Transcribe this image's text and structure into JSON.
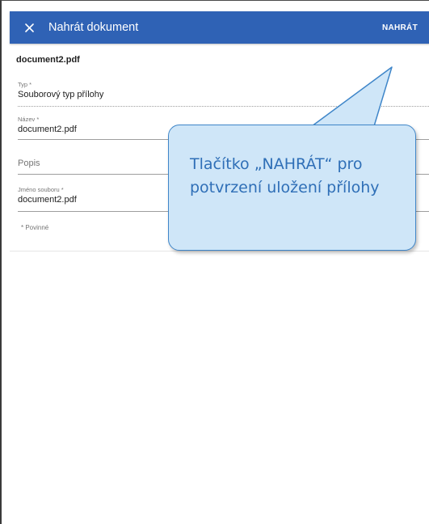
{
  "appbar": {
    "title": "Nahrát dokument",
    "upload_label": "NAHRÁT",
    "close_icon": "close-icon",
    "background": "#2f62b5"
  },
  "document": {
    "name": "document2.pdf"
  },
  "fields": {
    "typ": {
      "label": "Typ *",
      "value": "Souborový typ přílohy"
    },
    "nazev": {
      "label": "Název *",
      "value": "document2.pdf"
    },
    "popis": {
      "placeholder": "Popis"
    },
    "jmeno_souboru": {
      "label": "Jméno souboru *",
      "value": "document2.pdf"
    }
  },
  "required_note": "* Povinné",
  "callout": {
    "text": "Tlačítko „NAHRÁT“ pro potvrzení uložení přílohy",
    "fill": "#cfe6f8",
    "border": "#3f86c9",
    "text_color": "#2f6fb7"
  }
}
